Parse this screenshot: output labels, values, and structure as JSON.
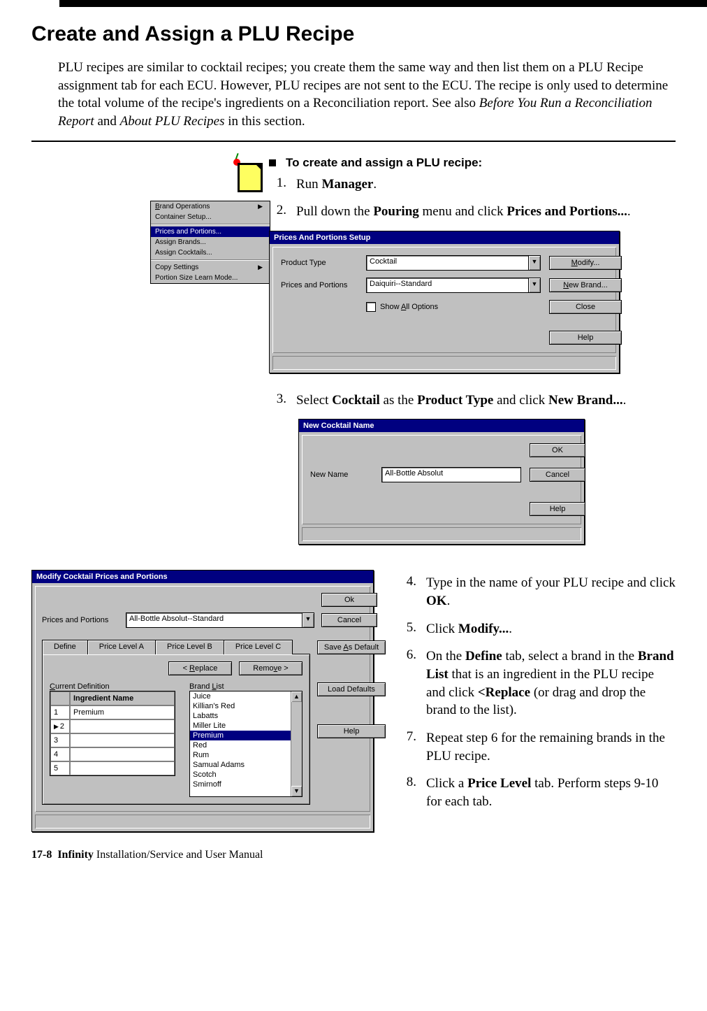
{
  "heading": "Create and Assign a PLU Recipe",
  "intro_parts": {
    "t1": "PLU recipes are similar to cocktail recipes; you create them the same way and then list them on a PLU Recipe assignment tab for each ECU. However, PLU recipes are not sent to the ECU. The recipe is only used to determine the total volume of the recipe's ingredients on a Reconciliation report. See also ",
    "i1": "Before You Run a Reconciliation Report",
    "t2": " and ",
    "i2": "About PLU Recipes",
    "t3": " in this section."
  },
  "proc_head": "To create and assign a PLU recipe:",
  "steps": {
    "s1": {
      "n": "1.",
      "a": "Run ",
      "b": "Manager",
      "c": "."
    },
    "s2": {
      "n": "2.",
      "a": "Pull down the ",
      "b": "Pouring",
      "c": " menu and click ",
      "d": "Prices and Portions...",
      "e": "."
    },
    "s3": {
      "n": "3.",
      "a": "Select ",
      "b": "Cocktail",
      "c": " as the ",
      "d": "Product Type",
      "e": " and click ",
      "f": "New Brand...",
      "g": "."
    },
    "s4": {
      "n": "4.",
      "a": "Type in the name of your PLU recipe and click ",
      "b": "OK",
      "c": "."
    },
    "s5": {
      "n": "5.",
      "a": "Click ",
      "b": "Modify...",
      "c": "."
    },
    "s6": {
      "n": "6.",
      "a": "On the ",
      "b": "Define",
      "c": " tab, select a brand in the ",
      "d": "Brand List",
      "e": " that is an ingredient in the PLU recipe and click ",
      "f": "<Replace",
      "g": " (or drag and drop the brand to the list)."
    },
    "s7": {
      "n": "7.",
      "a": "Repeat step 6 for the remaining brands in the PLU recipe."
    },
    "s8": {
      "n": "8.",
      "a": "Click a ",
      "b": "Price Level",
      "c": " tab.  Perform steps 9-10 for each tab."
    }
  },
  "pouring_menu": {
    "i1": "Brand Operations",
    "i2": "Container Setup...",
    "i3": "Prices and Portions...",
    "i4": "Assign Brands...",
    "i5": "Assign Cocktails...",
    "i6": "Copy Settings",
    "i7": "Portion Size Learn Mode..."
  },
  "dlg_prices": {
    "title": "Prices And Portions Setup",
    "lbl_product": "Product Type",
    "val_product": "Cocktail",
    "lbl_pp": "Prices and Portions",
    "val_pp": "Daiquiri--Standard",
    "chk": "Show All Options",
    "btn_modify": "Modify...",
    "btn_new": "New Brand...",
    "btn_close": "Close",
    "btn_help": "Help"
  },
  "dlg_newname": {
    "title": "New Cocktail Name",
    "lbl": "New Name",
    "val": "All-Bottle Absolut",
    "btn_ok": "OK",
    "btn_cancel": "Cancel",
    "btn_help": "Help"
  },
  "dlg_modify": {
    "title": "Modify Cocktail Prices and Portions",
    "lbl_pp": "Prices and Portions",
    "val_pp": "All-Bottle Absolut--Standard",
    "btn_ok": "Ok",
    "btn_cancel": "Cancel",
    "btn_save": "Save As Default",
    "btn_load": "Load Defaults",
    "btn_help": "Help",
    "tabs": {
      "t1": "Define",
      "t2": "Price Level A",
      "t3": "Price Level B",
      "t4": "Price Level C"
    },
    "btn_replace": "< Replace",
    "btn_remove": "Remove >",
    "lbl_current": "Current Definition",
    "lbl_brandlist": "Brand List",
    "hdr_ing": "Ingredient Name",
    "rows": {
      "r1n": "1",
      "r1v": "Premium",
      "r2n": "2",
      "r3n": "3",
      "r4n": "4",
      "r5n": "5"
    },
    "brands": {
      "b1": "Juice",
      "b2": "Killian's Red",
      "b3": "Labatts",
      "b4": "Miller Lite",
      "b5": "Premium",
      "b6": "Red",
      "b7": "Rum",
      "b8": "Samual Adams",
      "b9": "Scotch",
      "b10": "Smirnoff"
    }
  },
  "footer": {
    "page": "17-8",
    "bold": "Infinity",
    "rest": " Installation/Service and User Manual"
  }
}
